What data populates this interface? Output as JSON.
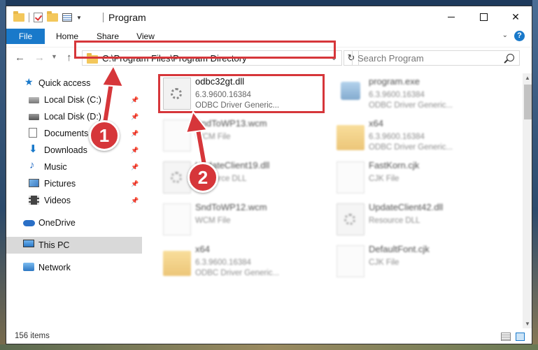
{
  "window": {
    "title": "Program",
    "controls": {
      "minimize": "minimize",
      "maximize": "maximize",
      "close": "✕"
    }
  },
  "ribbon": {
    "tabs": [
      {
        "label": "File",
        "active": true
      },
      {
        "label": "Home"
      },
      {
        "label": "Share"
      },
      {
        "label": "View"
      }
    ],
    "help": "?"
  },
  "nav": {
    "address": "C:\\Program Files\\Program Directory",
    "search_placeholder": "Search Program"
  },
  "sidebar": {
    "items": [
      {
        "label": "Quick access"
      },
      {
        "label": "Local Disk (C:)",
        "pinned": true
      },
      {
        "label": "Local Disk (D:)",
        "pinned": true
      },
      {
        "label": "Documents",
        "pinned": true
      },
      {
        "label": "Downloads",
        "pinned": true
      },
      {
        "label": "Music",
        "pinned": true
      },
      {
        "label": "Pictures",
        "pinned": true
      },
      {
        "label": "Videos",
        "pinned": true
      },
      {
        "label": "OneDrive"
      },
      {
        "label": "This PC",
        "selected": true
      },
      {
        "label": "Network"
      }
    ]
  },
  "files": [
    {
      "name": "odbc32gt.dll",
      "line1": "6.3.9600.16384",
      "line2": "ODBC Driver Generic...",
      "icon": "dll-icon",
      "highlighted": true
    },
    {
      "name": "program.exe",
      "line1": "6.3.9600.16384",
      "line2": "ODBC Driver Generic...",
      "icon": "exe-icon"
    },
    {
      "name": "SndToWP13.wcm",
      "line1": "WCM File",
      "line2": "",
      "icon": "file-icon"
    },
    {
      "name": "x64",
      "line1": "6.3.9600.16384",
      "line2": "ODBC Driver Generic...",
      "icon": "folder-icon"
    },
    {
      "name": "UpdateClient19.dll",
      "line1": "Resource DLL",
      "line2": "",
      "icon": "dll-icon"
    },
    {
      "name": "FastKorn.cjk",
      "line1": "CJK File",
      "line2": "",
      "icon": "file-icon"
    },
    {
      "name": "SndToWP12.wcm",
      "line1": "WCM File",
      "line2": "",
      "icon": "file-icon"
    },
    {
      "name": "UpdateClient42.dll",
      "line1": "Resource DLL",
      "line2": "",
      "icon": "dll-icon"
    },
    {
      "name": "x64",
      "line1": "6.3.9600.16384",
      "line2": "ODBC Driver Generic...",
      "icon": "folder-icon"
    },
    {
      "name": "DefaultFont.cjk",
      "line1": "CJK File",
      "line2": "",
      "icon": "file-icon"
    }
  ],
  "status": {
    "count": "156 items"
  },
  "annotations": {
    "step1": "1",
    "step2": "2",
    "color": "#d6363a"
  }
}
